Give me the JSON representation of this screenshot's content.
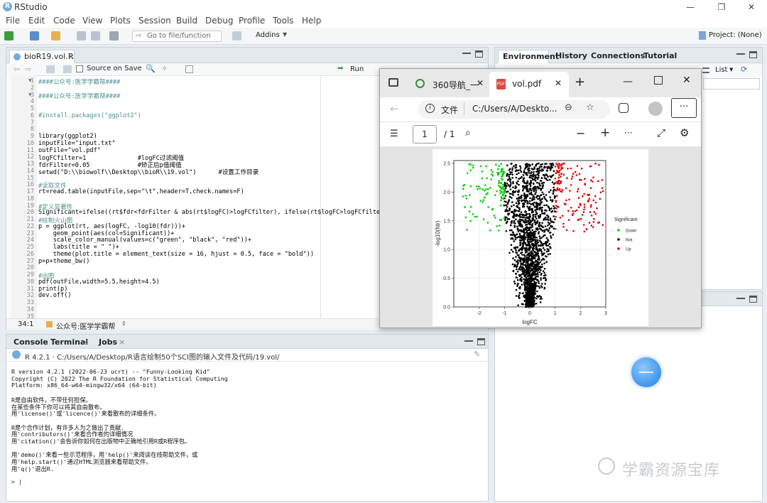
{
  "app": {
    "title": "RStudio",
    "logo": "R"
  },
  "menu": [
    "File",
    "Edit",
    "Code",
    "View",
    "Plots",
    "Session",
    "Build",
    "Debug",
    "Profile",
    "Tools",
    "Help"
  ],
  "toolbar": {
    "goto_placeholder": "Go to file/function",
    "addins": "Addins",
    "project": "Project: (None)"
  },
  "editor": {
    "tab": "bioR19.vol.R",
    "source_on_save": "Source on Save",
    "run": "Run",
    "lines": [
      {
        "n": "1",
        "t": "####公众号:医学学霸帮####",
        "c": "cmt"
      },
      {
        "n": "2",
        "t": "",
        "c": ""
      },
      {
        "n": "3",
        "t": "####公众号:医学学霸帮####",
        "c": "cmt"
      },
      {
        "n": "4",
        "t": "",
        "c": ""
      },
      {
        "n": "5",
        "t": "",
        "c": ""
      },
      {
        "n": "6",
        "t": "#install.packages(\"ggplot2\")",
        "c": "cmt"
      },
      {
        "n": "7",
        "t": "",
        "c": ""
      },
      {
        "n": "8",
        "t": "",
        "c": ""
      },
      {
        "n": "9",
        "t": "library(ggplot2)",
        "c": ""
      },
      {
        "n": "10",
        "t": "inputFile=\"input.txt\"",
        "c": ""
      },
      {
        "n": "11",
        "t": "outFile=\"vol.pdf\"",
        "c": ""
      },
      {
        "n": "12",
        "t": "logFCfilter=1              #logFC过滤阈值",
        "c": ""
      },
      {
        "n": "13",
        "t": "fdrFilter=0.05             #矫正后p值阈值",
        "c": ""
      },
      {
        "n": "14",
        "t": "setwd(\"D:\\\\biowolf\\\\Desktop\\\\bioR\\\\19.vol\")      #设置工作目录",
        "c": ""
      },
      {
        "n": "15",
        "t": "",
        "c": ""
      },
      {
        "n": "16",
        "t": "#读取文件",
        "c": "cmt"
      },
      {
        "n": "17",
        "t": "rt=read.table(inputFile,sep=\"\\t\",header=T,check.names=F)",
        "c": ""
      },
      {
        "n": "18",
        "t": "",
        "c": ""
      },
      {
        "n": "19",
        "t": "#定义显著性",
        "c": "cmt"
      },
      {
        "n": "20",
        "t": "Significant=ifelse((rt$fdr<fdrFilter & abs(rt$logFC)>logFCfilter), ifelse(rt$logFC>logFCfilter,\"U",
        "c": ""
      },
      {
        "n": "21",
        "t": "#绘制火山图",
        "c": "cmt"
      },
      {
        "n": "22",
        "t": "p = ggplot(rt, aes(logFC, -log10(fdr)))+",
        "c": ""
      },
      {
        "n": "23",
        "t": "    geom_point(aes(col=Significant))+",
        "c": ""
      },
      {
        "n": "24",
        "t": "    scale_color_manual(values=c(\"green\", \"black\", \"red\"))+",
        "c": ""
      },
      {
        "n": "25",
        "t": "    labs(title = \" \")+",
        "c": ""
      },
      {
        "n": "26",
        "t": "    theme(plot.title = element_text(size = 16, hjust = 0.5, face = \"bold\"))",
        "c": ""
      },
      {
        "n": "27",
        "t": "p=p+theme_bw()",
        "c": ""
      },
      {
        "n": "28",
        "t": "",
        "c": ""
      },
      {
        "n": "29",
        "t": "#出图",
        "c": "cmt"
      },
      {
        "n": "30",
        "t": "pdf(outFile,width=5.5,height=4.5)",
        "c": ""
      },
      {
        "n": "31",
        "t": "print(p)",
        "c": ""
      },
      {
        "n": "32",
        "t": "dev.off()",
        "c": ""
      },
      {
        "n": "33",
        "t": "",
        "c": ""
      },
      {
        "n": "34",
        "t": "",
        "c": ""
      },
      {
        "n": "35",
        "t": "",
        "c": ""
      }
    ],
    "status_pos": "34:1",
    "status_scope": "公众号:医学学霸帮"
  },
  "console": {
    "tabs": [
      "Console",
      "Terminal",
      "Jobs"
    ],
    "path": "R 4.2.1 · C:/Users/A/Desktop/R语言绘制50个SCI图的输入文件及代码/19.vol/",
    "lines": [
      "R version 4.2.1 (2022-06-23 ucrt) -- \"Funny-Looking Kid\"",
      "Copyright (C) 2022 The R Foundation for Statistical Computing",
      "Platform: x86_64-w64-mingw32/x64 (64-bit)",
      "",
      "R是自由软件，不带任何担保。",
      "在某些条件下你可以将其自由散布。",
      "用'license()'或'licence()'来看散布的详细条件。",
      "",
      "R是个合作计划，有许多人为之做出了贡献.",
      "用'contributors()'来看合作者的详细情况",
      "用'citation()'会告诉你如何在出版物中正确地引用R或R程序包。",
      "",
      "用'demo()'来看一些示范程序，用'help()'来阅读在线帮助文件，或",
      "用'help.start()'通过HTML浏览器来看帮助文件。",
      "用'q()'退出R.",
      "",
      "> |"
    ]
  },
  "env": {
    "tabs": [
      "Environment",
      "History",
      "Connections",
      "Tutorial"
    ],
    "list": "List"
  },
  "browser": {
    "tab1": "360导航_一",
    "tab2": "vol.pdf",
    "doc_label": "文件",
    "address": "C:/Users/A/Deskto...",
    "page": "1",
    "pages": "/ 1"
  },
  "watermark": "学霸资源宝库",
  "chart_data": {
    "type": "scatter",
    "xlabel": "logFC",
    "ylabel": "-log10(fdr)",
    "xlim": [
      -3,
      3
    ],
    "ylim": [
      0,
      2.55
    ],
    "xticks": [
      "-2",
      "-1",
      "0",
      "1",
      "2",
      "3"
    ],
    "yticks": [
      "0.0",
      "0.5",
      "1.0",
      "1.5",
      "2.0",
      "2.5"
    ],
    "legend_title": "Significant",
    "series": [
      {
        "name": "Down",
        "color": "#00cc00"
      },
      {
        "name": "Not",
        "color": "#000000"
      },
      {
        "name": "Up",
        "color": "#dd0000"
      }
    ]
  }
}
